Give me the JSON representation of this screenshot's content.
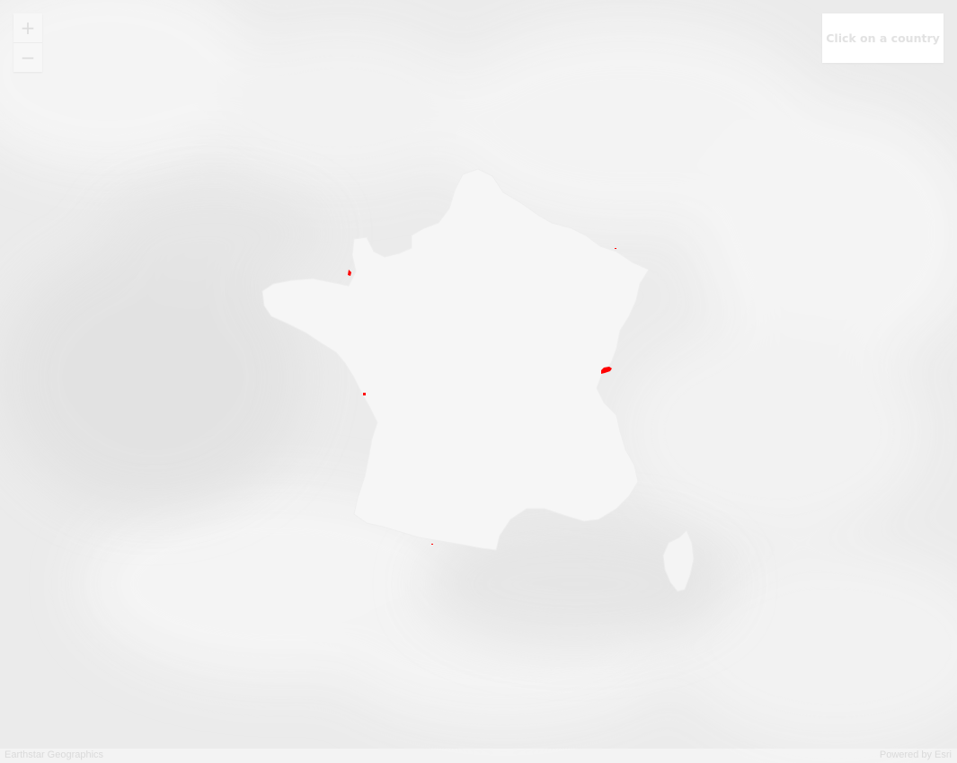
{
  "map": {
    "base_color": "#ebebeb",
    "highlight_color": "#ff0000",
    "country_fill": "#f5f5f5"
  },
  "zoom": {
    "in_icon": "plus-icon",
    "out_icon": "minus-icon",
    "in_glyph": "+",
    "out_glyph": "−"
  },
  "info_panel": {
    "text": "Click on a country"
  },
  "attribution": {
    "left": "Earthstar Geographics",
    "right": "Powered by Esri"
  }
}
